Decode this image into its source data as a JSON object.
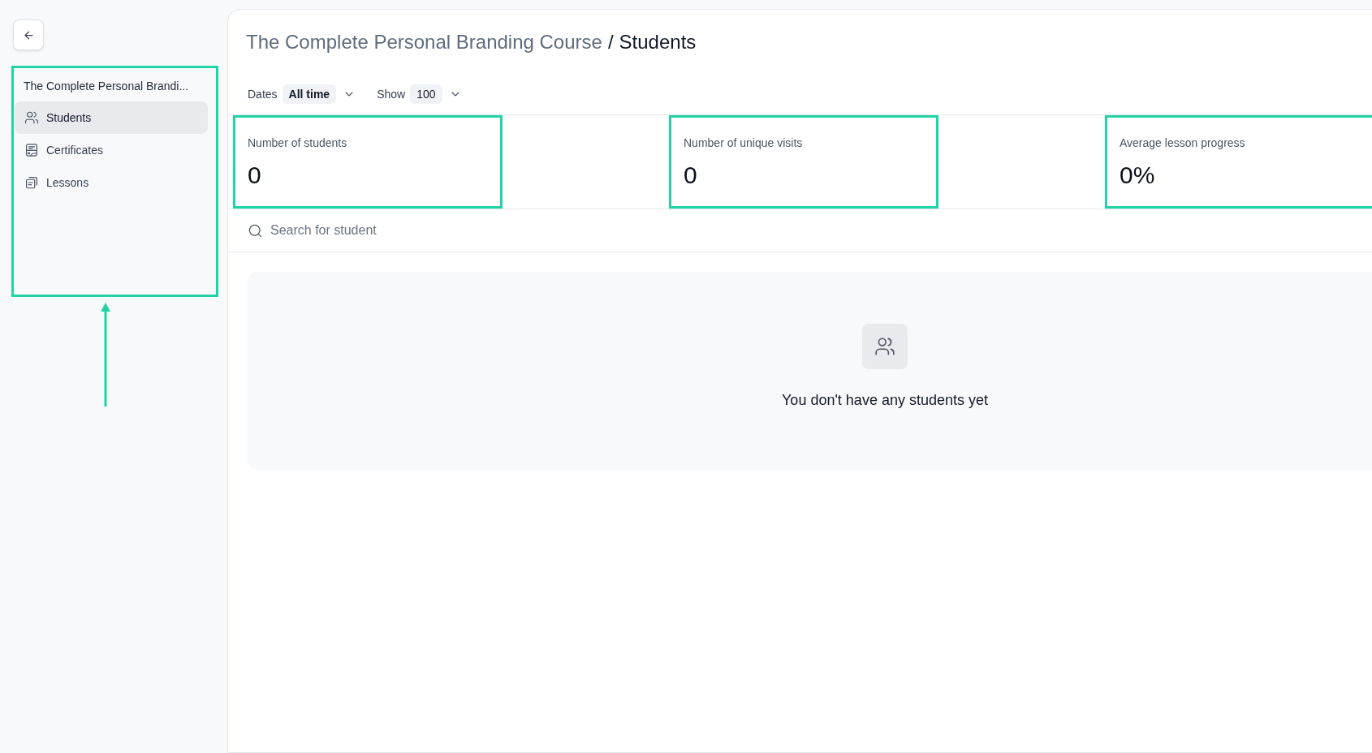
{
  "sidebar": {
    "highlighted": true,
    "pointer_arrow": true,
    "course_title": "The Complete Personal Brandi...",
    "items": [
      {
        "kind": "students",
        "label": "Students",
        "selected": true
      },
      {
        "kind": "certificates",
        "label": "Certificates",
        "selected": false
      },
      {
        "kind": "lessons",
        "label": "Lessons",
        "selected": false
      }
    ]
  },
  "header": {
    "breadcrumb": {
      "parent": "The Complete Personal Branding Course",
      "separator": "/",
      "current": "Students"
    }
  },
  "filters": [
    {
      "kind": "date_range",
      "label": "Dates",
      "value": "All time"
    },
    {
      "kind": "page_size",
      "label": "Show",
      "value": "100"
    }
  ],
  "stats": [
    {
      "label": "Number of students",
      "value": "0",
      "highlighted": true
    },
    {
      "label": "Number of unique visits",
      "value": "0",
      "highlighted": true
    },
    {
      "label": "Average lesson progress",
      "value": "0%",
      "highlighted": true
    }
  ],
  "search": {
    "placeholder": "Search for student"
  },
  "empty_state": {
    "message": "You don't have any students yet"
  }
}
